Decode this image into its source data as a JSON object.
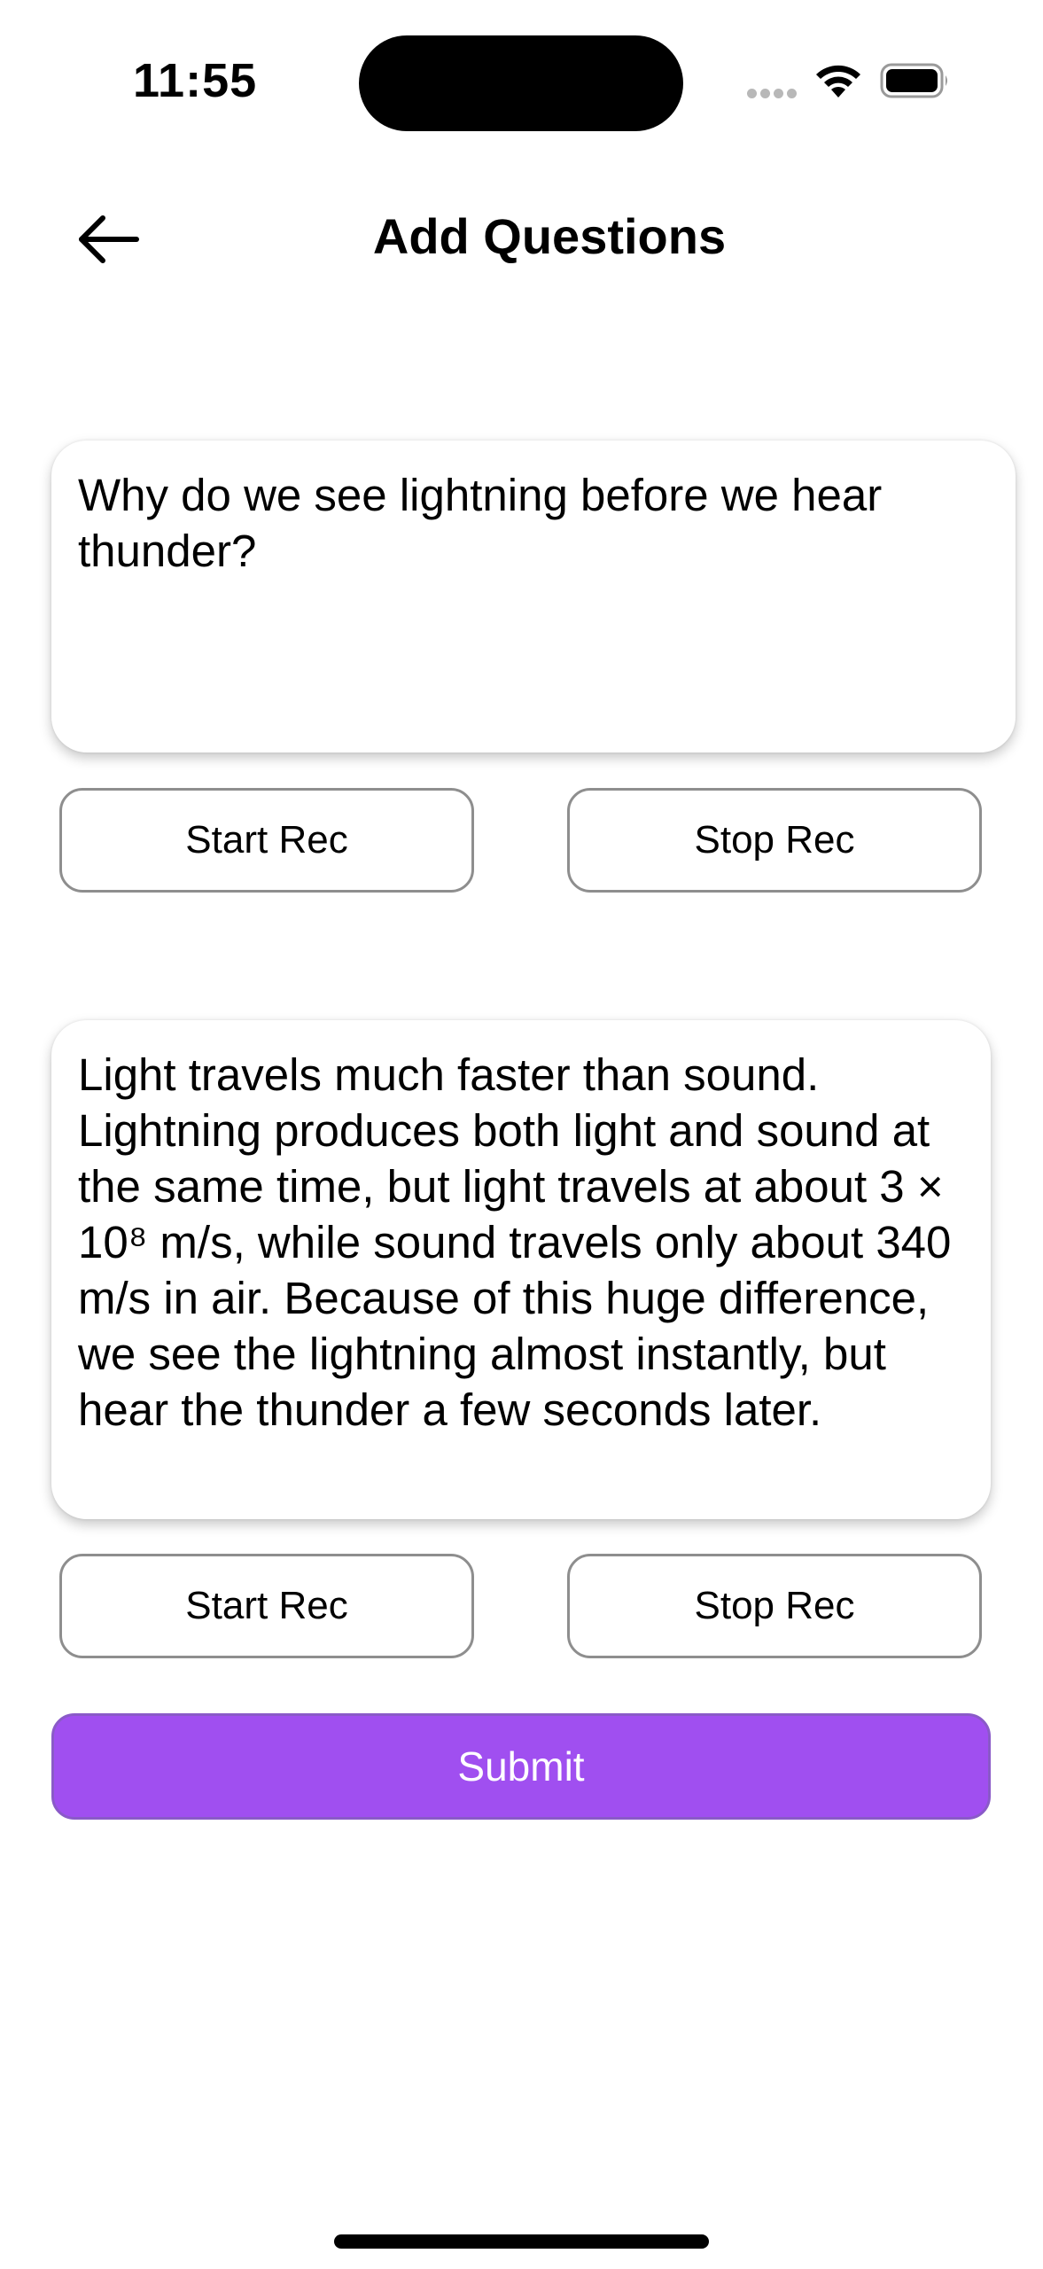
{
  "status_bar": {
    "time": "11:55",
    "icons": [
      "signal-dots-icon",
      "wifi-icon",
      "battery-icon"
    ]
  },
  "header": {
    "back_icon": "arrow-left-icon",
    "title": "Add Questions"
  },
  "question": {
    "text": "Why do we see lightning before we hear thunder?",
    "start_rec_label": "Start Rec",
    "stop_rec_label": "Stop Rec"
  },
  "answer": {
    "text": "Light travels much faster than sound. Lightning produces both light and sound at the same time, but light travels at about 3 × 10⁸ m/s, while sound travels only about 340 m/s in air. Because of this huge difference, we see the lightning almost instantly, but hear the thunder a few seconds later.",
    "start_rec_label": "Start Rec",
    "stop_rec_label": "Stop Rec"
  },
  "submit": {
    "label": "Submit"
  },
  "colors": {
    "submit_background": "#a04ff0",
    "button_border": "#8e8e8e",
    "text": "#000000"
  }
}
